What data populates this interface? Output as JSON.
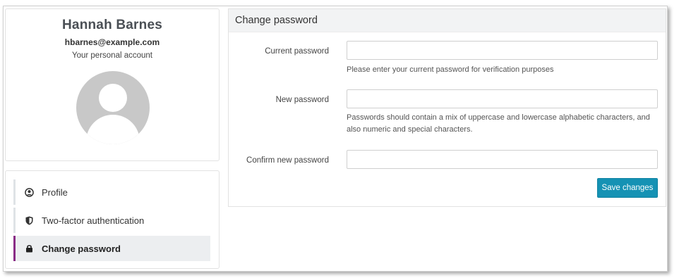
{
  "profile": {
    "name": "Hannah Barnes",
    "email": "hbarnes@example.com",
    "subtitle": "Your personal account",
    "avatar_icon": "user-silhouette-icon"
  },
  "nav": {
    "items": [
      {
        "label": "Profile",
        "icon": "user-circle-icon",
        "active": false
      },
      {
        "label": "Two-factor authentication",
        "icon": "shield-icon",
        "active": false
      },
      {
        "label": "Change password",
        "icon": "lock-icon",
        "active": true
      }
    ],
    "active_color": "#8a2c86"
  },
  "panel": {
    "title": "Change password",
    "fields": [
      {
        "label": "Current password",
        "value": "",
        "placeholder": "",
        "help": "Please enter your current password for verification purposes"
      },
      {
        "label": "New password",
        "value": "",
        "placeholder": "",
        "help": "Passwords should contain a mix of uppercase and lowercase alphabetic characters, and also numeric and special characters."
      },
      {
        "label": "Confirm new password",
        "value": "",
        "placeholder": "",
        "help": ""
      }
    ],
    "save_label": "Save changes",
    "save_color": "#1592b4"
  }
}
